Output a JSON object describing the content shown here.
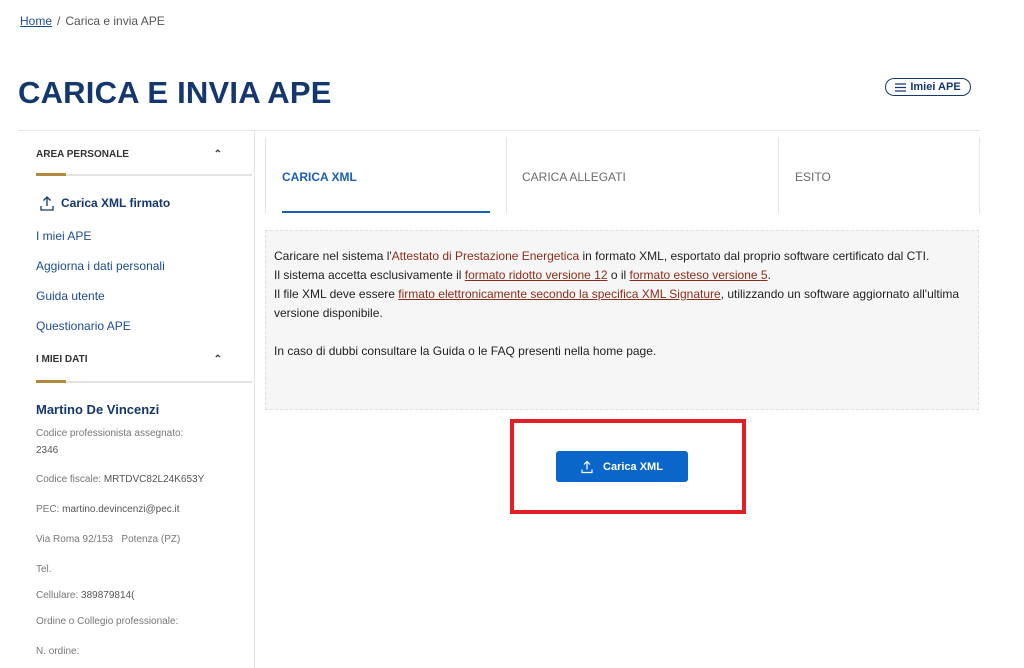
{
  "breadcrumb": {
    "home": "Home",
    "separator": "/",
    "current": "Carica e invia APE"
  },
  "page_title": "CARICA E INVIA APE",
  "my_ape_button": "Imiei APE",
  "sidebar": {
    "area_personale": "AREA PERSONALE",
    "active_item": "Carica XML firmato",
    "items": [
      "I miei APE",
      "Aggiorna i dati personali",
      "Guida utente",
      "Questionario APE"
    ],
    "miei_dati": "I MIEI DATI",
    "user": {
      "name": "Martino De Vincenzi",
      "codice_label": "Codice professionista assegnato:",
      "codice_value": "2346",
      "cf_label": "Codice fiscale:",
      "cf_value": "MRTDVC82L24K653Y",
      "pec_label": "PEC:",
      "pec_value": "martino.devincenzi@pec.it",
      "address": "Via Roma 92/153   Potenza (PZ)",
      "tel_label": "Tel.",
      "cell_label": "Cellulare:",
      "cell_value": "389879814(",
      "ordine_label": "Ordine o Collegio professionale:",
      "n_ordine_label": "N. ordine:"
    }
  },
  "tabs": [
    {
      "label": "CARICA XML",
      "active": true
    },
    {
      "label": "CARICA ALLEGATI",
      "active": false
    },
    {
      "label": "ESITO",
      "active": false
    }
  ],
  "info": {
    "l1_a": "Caricare nel sistema l'",
    "l1_hl": "Attestato di Prestazione Energetica",
    "l1_b": " in formato XML, esportato dal proprio software certificato dal CTI.",
    "l2_a": "Il sistema accetta esclusivamente il ",
    "l2_link1": "formato ridotto versione 12",
    "l2_b": " o il ",
    "l2_link2": "formato esteso versione 5",
    "l2_c": ".",
    "l3_a": "Il file XML deve essere ",
    "l3_link": "firmato elettronicamente secondo la specifica XML Signature",
    "l3_b": ", utilizzando un software aggiornato all'ultima versione disponibile.",
    "l4": "In caso di dubbi consultare la Guida o le FAQ presenti nella home page."
  },
  "upload_button": "Carica XML",
  "colors": {
    "primary": "#0a66c8",
    "title": "#14376e",
    "accent": "#b08a3c",
    "highlight_border": "#e31f25"
  },
  "icons": {
    "upload": "upload-icon",
    "list": "list-icon",
    "chevron": "chevron-up-icon"
  }
}
